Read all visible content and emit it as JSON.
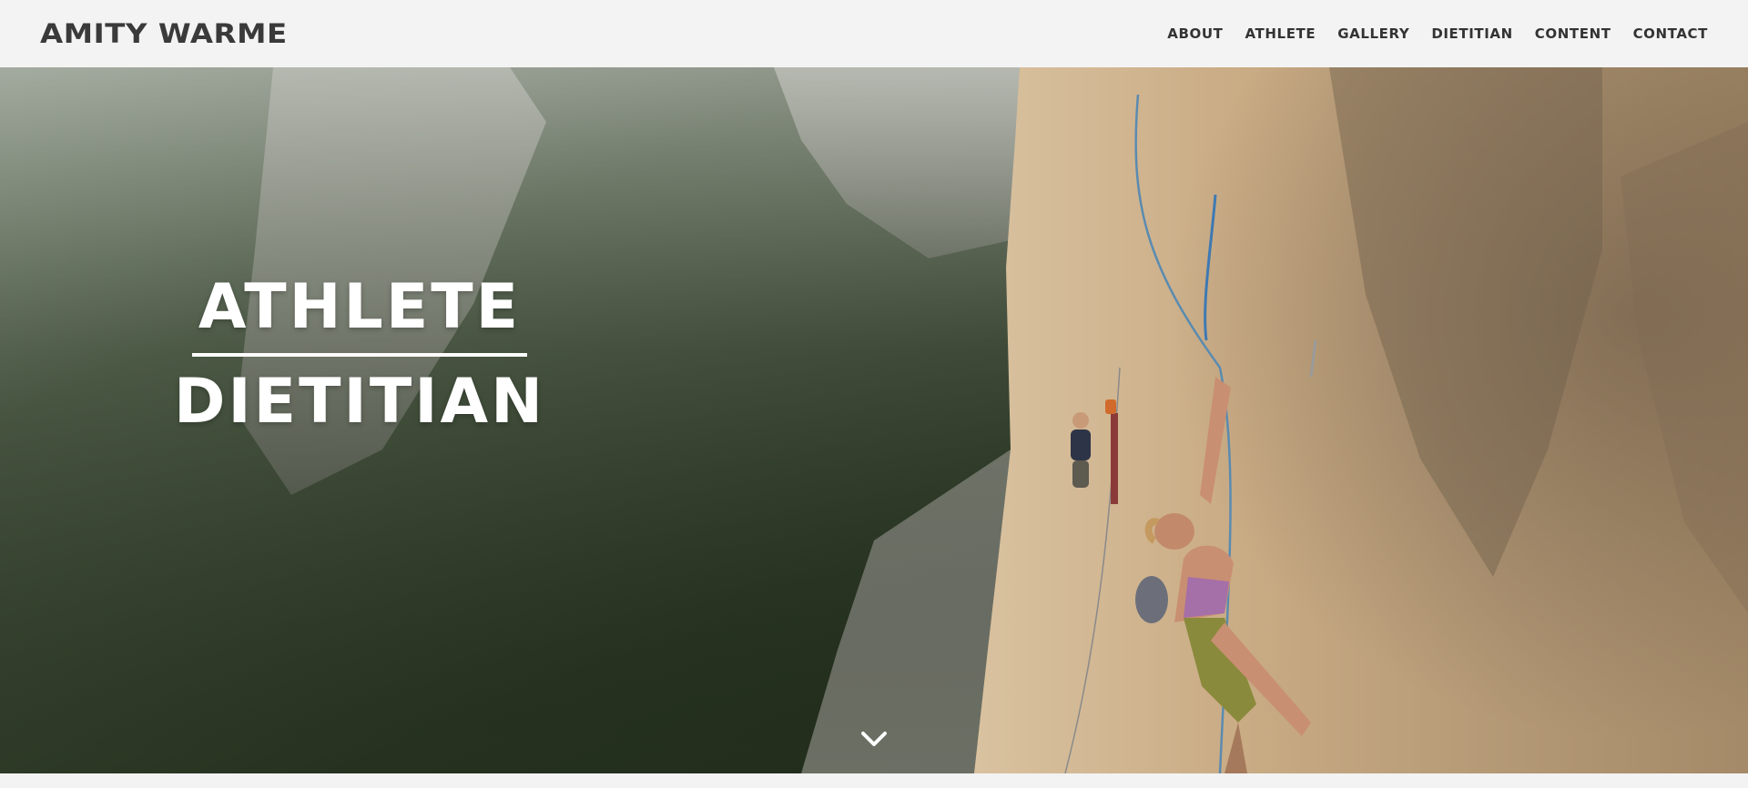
{
  "header": {
    "brand": "AMITY WARME",
    "nav": [
      {
        "label": "ABOUT"
      },
      {
        "label": "ATHLETE"
      },
      {
        "label": "GALLERY"
      },
      {
        "label": "DIETITIAN"
      },
      {
        "label": "CONTENT"
      },
      {
        "label": "CONTACT"
      }
    ]
  },
  "hero": {
    "title_line1": "ATHLETE",
    "title_line2": "DIETITIAN",
    "scroll_icon": "chevron-down-icon",
    "image_alt_icon": "climber-photo"
  },
  "colors": {
    "header_bg": "#f3f3f3",
    "header_text": "#333333",
    "hero_text": "#ffffff"
  }
}
